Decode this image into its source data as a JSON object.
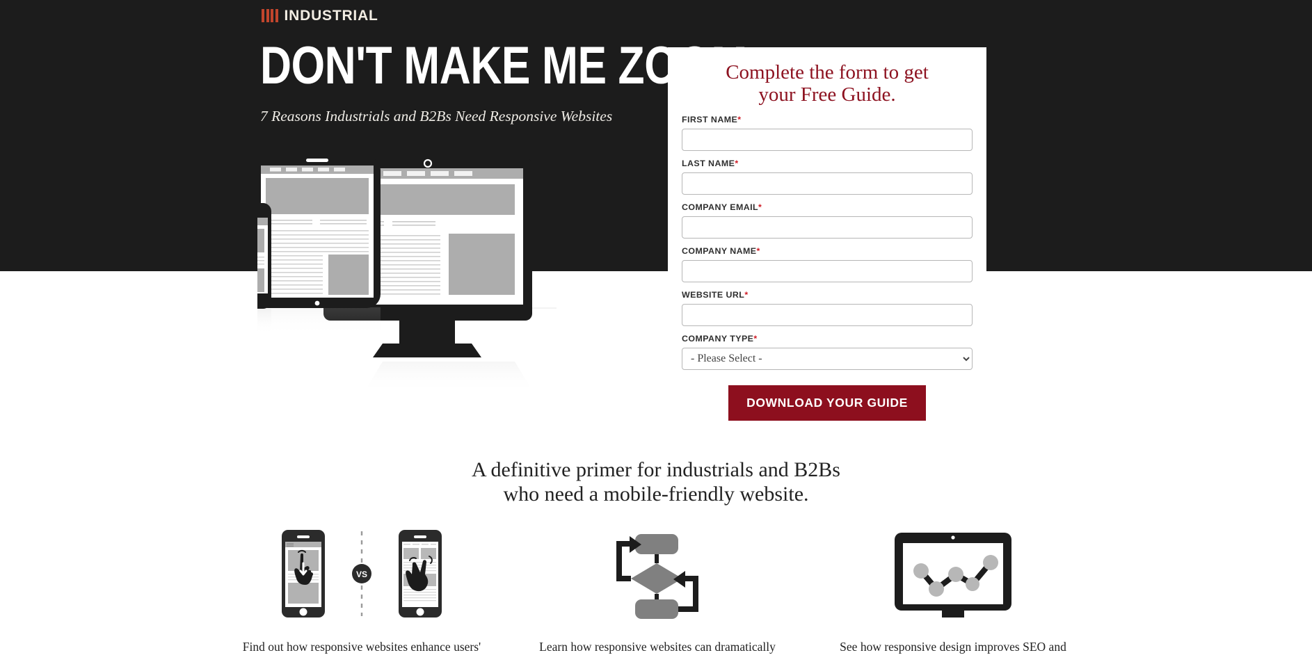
{
  "brand": {
    "logo_icon": "bars-logo-icon",
    "name": "INDUSTRIAL",
    "accent_color": "#c1452c"
  },
  "hero": {
    "headline": "DON'T MAKE ME ZOOM",
    "subheadline": "7 Reasons Industrials and B2Bs Need Responsive Websites",
    "background_color": "#1c1c1c",
    "illustration": "responsive-devices-illustration"
  },
  "form": {
    "heading_line1": "Complete the form to get",
    "heading_line2": "your Free Guide.",
    "heading_color": "#8d1220",
    "required_marker": "*",
    "fields": [
      {
        "label": "FIRST NAME",
        "required": true,
        "type": "text",
        "value": "",
        "placeholder": ""
      },
      {
        "label": "LAST NAME",
        "required": true,
        "type": "text",
        "value": "",
        "placeholder": ""
      },
      {
        "label": "COMPANY EMAIL",
        "required": true,
        "type": "text",
        "value": "",
        "placeholder": ""
      },
      {
        "label": "COMPANY NAME",
        "required": true,
        "type": "text",
        "value": "",
        "placeholder": ""
      },
      {
        "label": "WEBSITE URL",
        "required": true,
        "type": "text",
        "value": "",
        "placeholder": ""
      },
      {
        "label": "COMPANY TYPE",
        "required": true,
        "type": "select",
        "value": "- Please Select -",
        "placeholder": ""
      }
    ],
    "select_options": [
      "- Please Select -"
    ],
    "submit_label": "DOWNLOAD YOUR GUIDE",
    "submit_color": "#8d0f1e"
  },
  "primer": {
    "line1": "A definitive primer for industrials and B2Bs",
    "line2": "who need a mobile-friendly website."
  },
  "features": [
    {
      "icon": "phone-tap-vs-pinch-icon",
      "vs_label": "VS",
      "text": "Find out how responsive websites enhance users'"
    },
    {
      "icon": "flowchart-icon",
      "text": "Learn how responsive websites can dramatically"
    },
    {
      "icon": "monitor-line-chart-icon",
      "text": "See how responsive design improves SEO and"
    }
  ]
}
